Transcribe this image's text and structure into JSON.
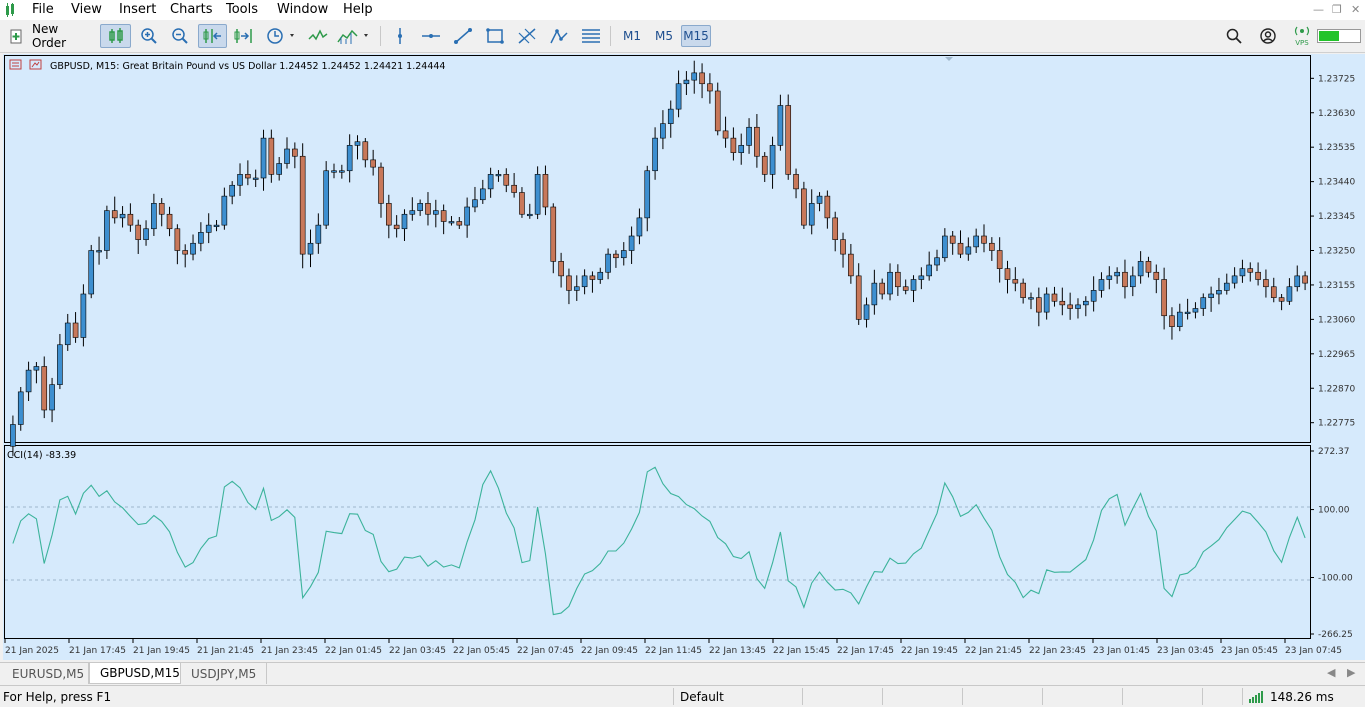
{
  "menu": {
    "items": [
      "File",
      "View",
      "Insert",
      "Charts",
      "Tools",
      "Window",
      "Help"
    ]
  },
  "toolbar": {
    "new_order_label": "New Order",
    "timeframes": [
      "M1",
      "M5",
      "M15"
    ],
    "active_timeframe": "M15",
    "icons": [
      "new-order-icon",
      "candles-icon",
      "zoom-in-icon",
      "zoom-out-icon",
      "scroll-icon",
      "shift-icon",
      "clock-icon",
      "indicators-icon",
      "templates-icon",
      "vertical-line-icon",
      "horizontal-line-icon",
      "trendline-icon",
      "rectangle-icon",
      "fibonacci-icon",
      "channel-icon",
      "grid-lines-icon",
      "search-icon",
      "account-icon",
      "signal-icon",
      "connection-bars-icon"
    ]
  },
  "chart": {
    "symbol_title": "GBPUSD, M15:  Great Britain Pound vs US Dollar  1.24452 1.24452 1.24421 1.24444",
    "price_labels": [
      "1.23725",
      "1.23630",
      "1.23535",
      "1.23440",
      "1.23345",
      "1.23250",
      "1.23155",
      "1.23060",
      "1.22965",
      "1.22870",
      "1.22775"
    ],
    "indicator_title": "CCI(14) -83.39",
    "indicator_labels": [
      "272.37",
      "100.00",
      "-100.00",
      "-266.25"
    ],
    "time_labels": [
      "21 Jan 2025",
      "21 Jan 17:45",
      "21 Jan 19:45",
      "21 Jan 21:45",
      "21 Jan 23:45",
      "22 Jan 01:45",
      "22 Jan 03:45",
      "22 Jan 05:45",
      "22 Jan 07:45",
      "22 Jan 09:45",
      "22 Jan 11:45",
      "22 Jan 13:45",
      "22 Jan 15:45",
      "22 Jan 17:45",
      "22 Jan 19:45",
      "22 Jan 21:45",
      "22 Jan 23:45",
      "23 Jan 01:45",
      "23 Jan 03:45",
      "23 Jan 05:45",
      "23 Jan 07:45"
    ],
    "colors": {
      "background": "#d6eafc",
      "bull": "#3d8fd0",
      "bear": "#c8785a",
      "cci": "#3cb39b",
      "axis_text": "#333333"
    }
  },
  "chart_data": {
    "type": "candlestick",
    "ylim": [
      1.2273,
      1.2377
    ],
    "cci_ylim": [
      -266.25,
      272.37
    ],
    "closes": [
      1.2277,
      1.2286,
      1.2292,
      1.2293,
      1.2281,
      1.2288,
      1.2299,
      1.2305,
      1.2301,
      1.2313,
      1.2325,
      1.2325,
      1.2336,
      1.2334,
      1.2335,
      1.2332,
      1.2328,
      1.2331,
      1.2338,
      1.2335,
      1.2331,
      1.2325,
      1.2324,
      1.2327,
      1.233,
      1.2332,
      1.2332,
      1.234,
      1.2343,
      1.2346,
      1.2345,
      1.2345,
      1.2356,
      1.2346,
      1.2349,
      1.2353,
      1.2351,
      1.2324,
      1.2327,
      1.2332,
      1.2347,
      1.2347,
      1.2347,
      1.2354,
      1.2355,
      1.235,
      1.2348,
      1.2338,
      1.2332,
      1.2331,
      1.2335,
      1.2336,
      1.2338,
      1.2335,
      1.2336,
      1.2333,
      1.2333,
      1.2332,
      1.2337,
      1.2339,
      1.2342,
      1.2346,
      1.2346,
      1.2343,
      1.2341,
      1.2335,
      1.2335,
      1.2346,
      1.2337,
      1.2322,
      1.2318,
      1.2314,
      1.2315,
      1.2318,
      1.2317,
      1.2319,
      1.2324,
      1.2323,
      1.2325,
      1.2329,
      1.2334,
      1.2347,
      1.2356,
      1.236,
      1.2364,
      1.2371,
      1.2372,
      1.2374,
      1.2371,
      1.2369,
      1.2358,
      1.2356,
      1.2352,
      1.2354,
      1.2359,
      1.2351,
      1.2346,
      1.2354,
      1.2365,
      1.2346,
      1.2342,
      1.2332,
      1.2338,
      1.234,
      1.2334,
      1.2328,
      1.2324,
      1.2318,
      1.2306,
      1.231,
      1.2316,
      1.2313,
      1.2319,
      1.2315,
      1.2314,
      1.2317,
      1.2318,
      1.2321,
      1.2323,
      1.2329,
      1.2327,
      1.2324,
      1.2326,
      1.2329,
      1.2327,
      1.2325,
      1.232,
      1.2317,
      1.2316,
      1.2312,
      1.2312,
      1.2308,
      1.2313,
      1.2311,
      1.231,
      1.2309,
      1.231,
      1.2311,
      1.2314,
      1.2317,
      1.2318,
      1.2319,
      1.2315,
      1.2318,
      1.2322,
      1.2319,
      1.2317,
      1.2307,
      1.2304,
      1.2308,
      1.2308,
      1.2309,
      1.2312,
      1.2313,
      1.2314,
      1.2316,
      1.2318,
      1.232,
      1.2319,
      1.2317,
      1.2315,
      1.2312,
      1.2311,
      1.2315,
      1.2318,
      1.2316
    ]
  },
  "tabs": {
    "items": [
      "EURUSD,M5",
      "GBPUSD,M15",
      "USDJPY,M5"
    ],
    "active": "GBPUSD,M15"
  },
  "status": {
    "help": "For Help, press F1",
    "profile": "Default",
    "ping": "148.26 ms"
  }
}
